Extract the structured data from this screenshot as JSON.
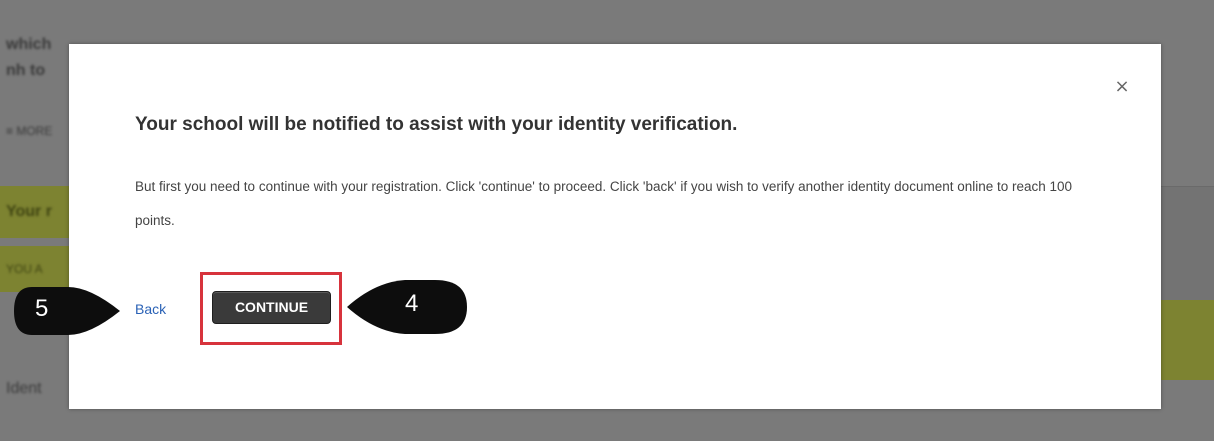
{
  "modal": {
    "close_symbol": "×",
    "title": "Your school will be notified to assist with your identity verification.",
    "body": "But first you need to continue with your registration. Click 'continue' to proceed. Click 'back' if you wish to verify another identity document online to reach 100 points.",
    "back_label": "Back",
    "continue_label": "CONTINUE"
  },
  "callouts": {
    "back": "5",
    "continue": "4"
  },
  "background": {
    "partial_text_1": "which",
    "partial_text_2": "nh to",
    "partial_text_3": "≡ MORE",
    "partial_text_4": "Your r",
    "partial_text_5": "YOU A",
    "partial_text_6": "Ident"
  },
  "colors": {
    "overlay": "#767676",
    "modal_bg": "#ffffff",
    "link": "#2a62b6",
    "button_bg": "#3a3a3a",
    "highlight": "#d7333c",
    "callout": "#0d0d0d",
    "bg_green": "#7d8331"
  },
  "icons": {
    "close": "close-icon",
    "callout_right": "pointer-callout-right-icon",
    "callout_left": "pointer-callout-left-icon"
  }
}
